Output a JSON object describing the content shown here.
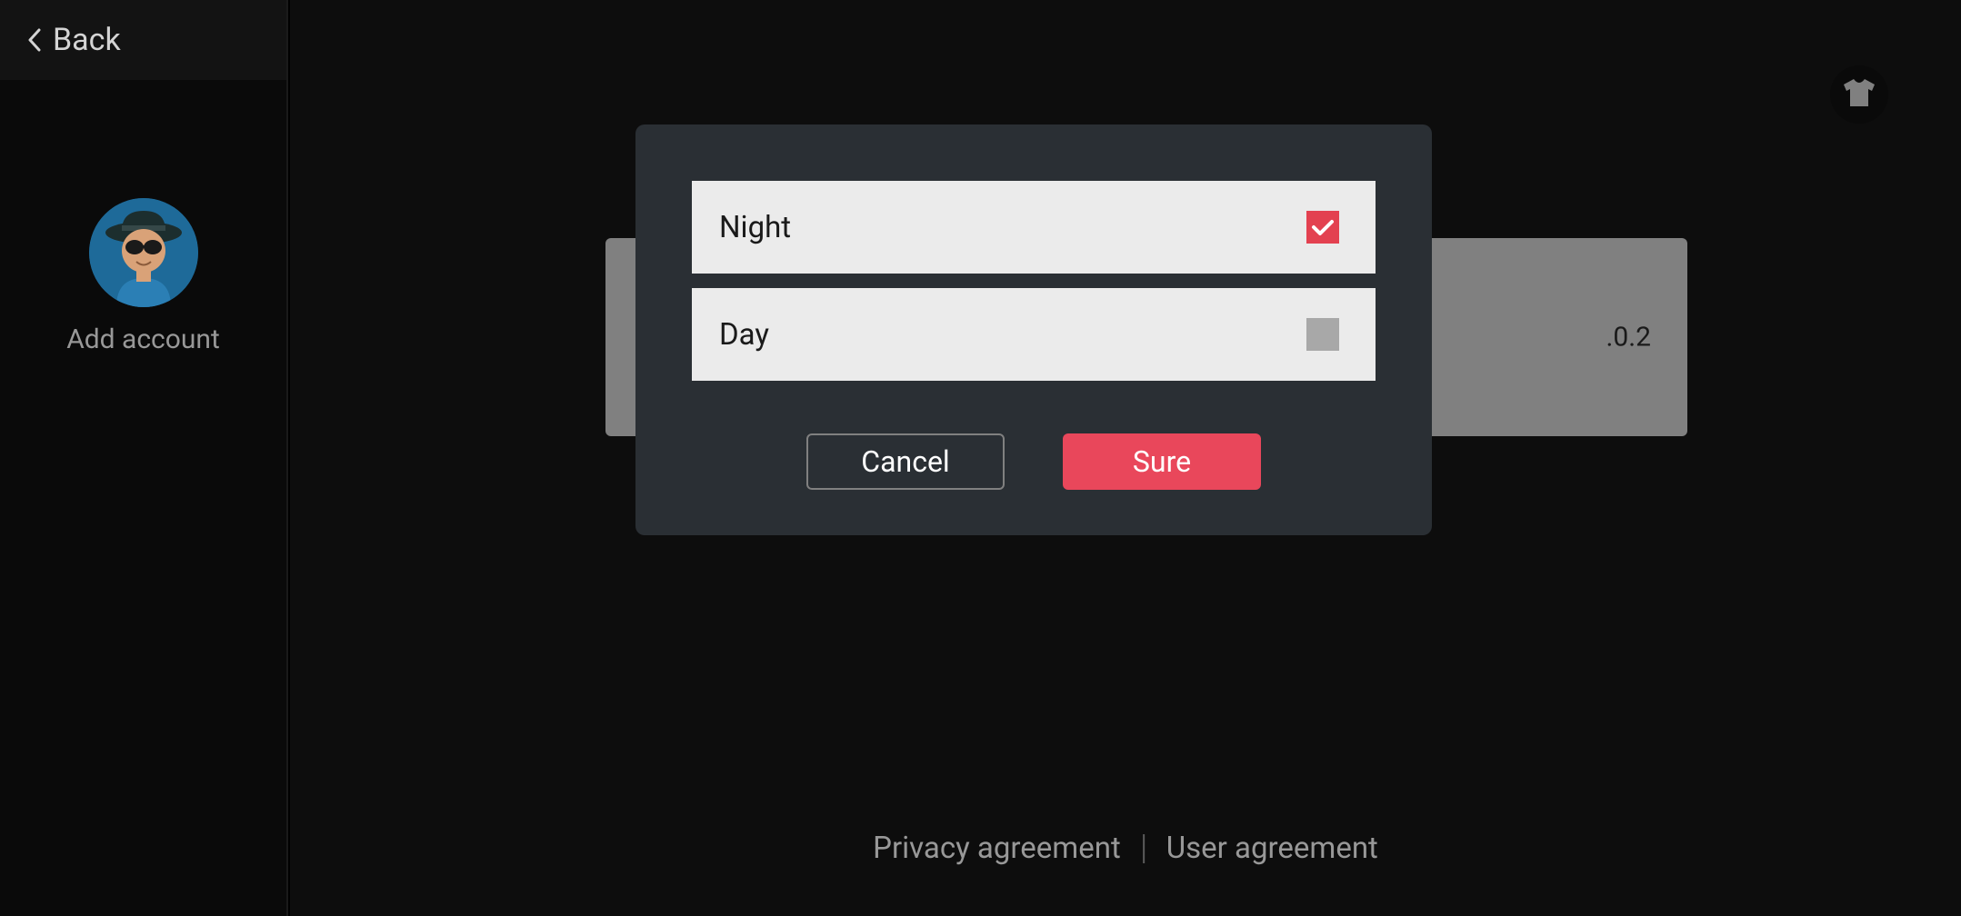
{
  "sidebar": {
    "back_label": "Back",
    "add_account_label": "Add account"
  },
  "main": {
    "version_number": ".0.2"
  },
  "theme_dialog": {
    "options": [
      {
        "label": "Night",
        "checked": true
      },
      {
        "label": "Day",
        "checked": false
      }
    ],
    "cancel_label": "Cancel",
    "sure_label": "Sure"
  },
  "footer": {
    "privacy_label": "Privacy agreement",
    "user_label": "User agreement"
  }
}
